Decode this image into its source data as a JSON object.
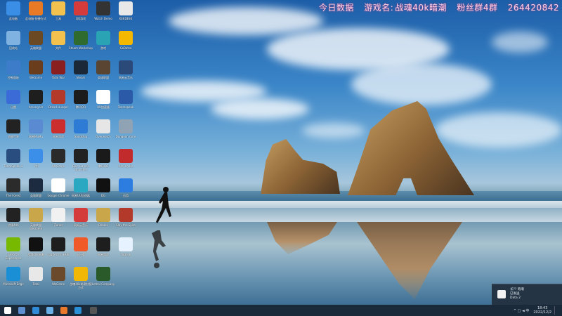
{
  "overlay": {
    "part1": "今日数据",
    "part2": "游戏名:",
    "part3": "战魂40k暗潮",
    "part4": "粉丝群4群",
    "part5": "264420842"
  },
  "desktop_icons": [
    {
      "label": "此电脑",
      "icon": "computer-icon",
      "color": "#3a8ee6"
    },
    {
      "label": "此电脑-快捷方式",
      "icon": "app-icon",
      "color": "#e87a25"
    },
    {
      "label": "工具",
      "icon": "folder-icon",
      "color": "#f2c14e"
    },
    {
      "label": "QQ游戏",
      "icon": "app-icon",
      "color": "#d63b3b"
    },
    {
      "label": "Watch Demo",
      "icon": "game-icon",
      "color": "#333333"
    },
    {
      "label": "KEEDESK",
      "icon": "file-icon",
      "color": "#e8e8e8"
    },
    {
      "label": "回收站",
      "icon": "recycle-bin-icon",
      "color": "#7fb2e0"
    },
    {
      "label": "英雄联盟",
      "icon": "game-icon",
      "color": "#6b4a23"
    },
    {
      "label": "文件",
      "icon": "folder-icon",
      "color": "#f2c14e"
    },
    {
      "label": "Steam Workshop",
      "icon": "game-icon",
      "color": "#2f6a2f"
    },
    {
      "label": "游戏",
      "icon": "game-icon",
      "color": "#2aa3b5"
    },
    {
      "label": "GeBatse",
      "icon": "game-icon",
      "color": "#f5b800"
    },
    {
      "label": "控制面板",
      "icon": "control-panel-icon",
      "color": "#3d7cc9"
    },
    {
      "label": "WeGame",
      "icon": "game-icon",
      "color": "#6a3d1d"
    },
    {
      "label": "Total War",
      "icon": "game-icon",
      "color": "#8a1f1f"
    },
    {
      "label": "Steam",
      "icon": "steam-icon",
      "color": "#1b2838"
    },
    {
      "label": "英雄联盟",
      "icon": "game-icon",
      "color": "#5a4533"
    },
    {
      "label": "网易云音乐",
      "icon": "app-icon",
      "color": "#2b4a7a"
    },
    {
      "label": "迅雷",
      "icon": "app-icon",
      "color": "#3a6bd6"
    },
    {
      "label": "Among Us",
      "icon": "game-icon",
      "color": "#1e1e1e"
    },
    {
      "label": "Dread Hunger",
      "icon": "game-icon",
      "color": "#b33a2b"
    },
    {
      "label": "腾讯QQ",
      "icon": "qq-icon",
      "color": "#1c1c1c"
    },
    {
      "label": "UU加速器",
      "icon": "app-icon",
      "color": "#ffffff"
    },
    {
      "label": "Teamspeak",
      "icon": "app-icon",
      "color": "#2a5aa8"
    },
    {
      "label": "战舰世界",
      "icon": "game-icon",
      "color": "#222222"
    },
    {
      "label": "网易MuMu",
      "icon": "app-icon",
      "color": "#5a8ad1"
    },
    {
      "label": "网易游戏",
      "icon": "app-icon",
      "color": "#cc2e2e"
    },
    {
      "label": "Sandship",
      "icon": "game-icon",
      "color": "#2e7bd6"
    },
    {
      "label": "Overwatch",
      "icon": "game-icon",
      "color": "#e6e6e6"
    },
    {
      "label": "Dungeon Core",
      "icon": "game-icon",
      "color": "#8fa3b5"
    },
    {
      "label": "TeamSpeak 3",
      "icon": "app-icon",
      "color": "#2a4d7f"
    },
    {
      "label": "飞书",
      "icon": "app-icon",
      "color": "#3c8fe8"
    },
    {
      "label": "WeGame",
      "icon": "game-icon",
      "color": "#2a2a2a"
    },
    {
      "label": "Epic Games Launcher",
      "icon": "epic-icon",
      "color": "#222222"
    },
    {
      "label": "腾讯QQ",
      "icon": "qq-icon",
      "color": "#1a1a1a"
    },
    {
      "label": "Among Us",
      "icon": "game-icon",
      "color": "#c22b2b"
    },
    {
      "label": "The Forest",
      "icon": "game-icon",
      "color": "#2b2b2b"
    },
    {
      "label": "英雄联盟",
      "icon": "game-icon",
      "color": "#1c2b3f"
    },
    {
      "label": "Google Chrome",
      "icon": "chrome-icon",
      "color": "#ffffff"
    },
    {
      "label": "网易UU加速器",
      "icon": "app-icon",
      "color": "#2aa8c2"
    },
    {
      "label": "DG",
      "icon": "app-icon",
      "color": "#111111"
    },
    {
      "label": "迅游",
      "icon": "app-icon",
      "color": "#2d7de0"
    },
    {
      "label": "战锤40K",
      "icon": "game-icon",
      "color": "#222222"
    },
    {
      "label": "英雄联盟WeGame",
      "icon": "game-icon",
      "color": "#c9a64a"
    },
    {
      "label": "iTunes",
      "icon": "music-icon",
      "color": "#f1f1f1"
    },
    {
      "label": "网易云音乐",
      "icon": "music-icon",
      "color": "#d43c3c"
    },
    {
      "label": "Roblox",
      "icon": "game-icon",
      "color": "#c9a64a"
    },
    {
      "label": "Slay the Spire",
      "icon": "game-icon",
      "color": "#b33a2b"
    },
    {
      "label": "GeForce Experience",
      "icon": "nvidia-icon",
      "color": "#76b900"
    },
    {
      "label": "战魂40k暗潮",
      "icon": "app-icon",
      "color": "#111111"
    },
    {
      "label": "Logitech G HUB",
      "icon": "app-icon",
      "color": "#1e1e1e"
    },
    {
      "label": "向日葵",
      "icon": "app-icon",
      "color": "#f05a28"
    },
    {
      "label": "网易游戏",
      "icon": "app-icon",
      "color": "#1e1e1e"
    },
    {
      "label": "ToDesk",
      "icon": "app-icon",
      "color": "#e6f2ff"
    },
    {
      "label": "Microsoft Edge",
      "icon": "edge-icon",
      "color": "#1a8fd6"
    },
    {
      "label": "Total",
      "icon": "folder-icon",
      "color": "#e8e8e8"
    },
    {
      "label": "WeGame",
      "icon": "game-icon",
      "color": "#6a4a2a"
    },
    {
      "label": "战魂40k暗潮快捷方式",
      "icon": "app-icon",
      "color": "#f2b705"
    },
    {
      "label": "Lethal Company",
      "icon": "game-icon",
      "color": "#2a5a2a"
    }
  ],
  "taskbar": {
    "items": [
      {
        "name": "start-button",
        "color": "#ffffff"
      },
      {
        "name": "taskbar-steam",
        "color": "#5b8fd0"
      },
      {
        "name": "taskbar-app-blue",
        "color": "#2f8ad8"
      },
      {
        "name": "taskbar-app-circle",
        "color": "#6ab0e8"
      },
      {
        "name": "taskbar-app-orange",
        "color": "#e8782a"
      },
      {
        "name": "taskbar-edge",
        "color": "#2a8fd6"
      },
      {
        "name": "taskbar-app-dark",
        "color": "#555555"
      }
    ],
    "tray_icons": "^ □ ◄ 中",
    "time": "18:43",
    "date": "2022/12/2"
  },
  "notification": {
    "line1": "长?? 暗潮",
    "line2": "已发送",
    "line3": "Data 2"
  }
}
